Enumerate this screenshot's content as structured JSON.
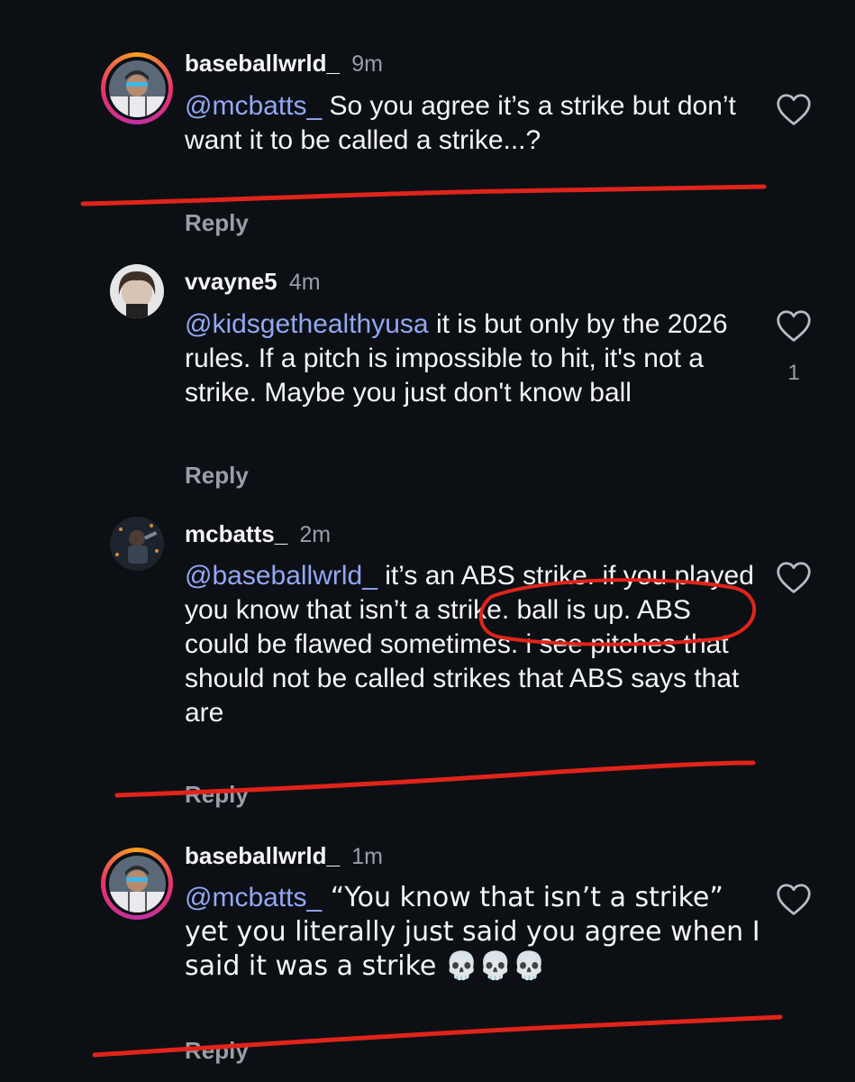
{
  "comments": [
    {
      "username": "baseballwrld_",
      "time": "9m",
      "mention": "@mcbatts_",
      "text": " So you agree it’s a strike but don’t want it to be called a strike...?",
      "reply_label": "Reply",
      "avatar_icon": "profile-photo-story-ring",
      "liked": false,
      "like_count": ""
    },
    {
      "username": "vvayne5",
      "time": "4m",
      "mention": "@kidsgethealthyusa",
      "text": " it is but only by the 2026 rules.  If a pitch is impossible to hit, it's not a strike.  Maybe you just don't know ball",
      "reply_label": "Reply",
      "avatar_icon": "profile-photo",
      "liked": false,
      "like_count": "1"
    },
    {
      "username": "mcbatts_",
      "time": "2m",
      "mention": "@baseballwrld_",
      "text": " it’s an ABS strike. if you played you know that isn’t a strike. ball is up. ABS could be flawed sometimes. i see pitches that should not be called strikes that ABS says that are",
      "reply_label": "Reply",
      "avatar_icon": "profile-photo",
      "liked": false,
      "like_count": ""
    },
    {
      "username": "baseballwrld_",
      "time": "1m",
      "mention": "@mcbatts_",
      "text": " “You know that isn’t a strike” yet you literally just said you agree when I said it was a strike 💀💀💀",
      "reply_label": "Reply",
      "avatar_icon": "profile-photo-story-ring",
      "liked": false,
      "like_count": ""
    }
  ],
  "colors": {
    "background": "#0c0f14",
    "mention": "#93a8f4",
    "secondary_text": "#9a9ea6",
    "annotation": "#e0241b"
  }
}
